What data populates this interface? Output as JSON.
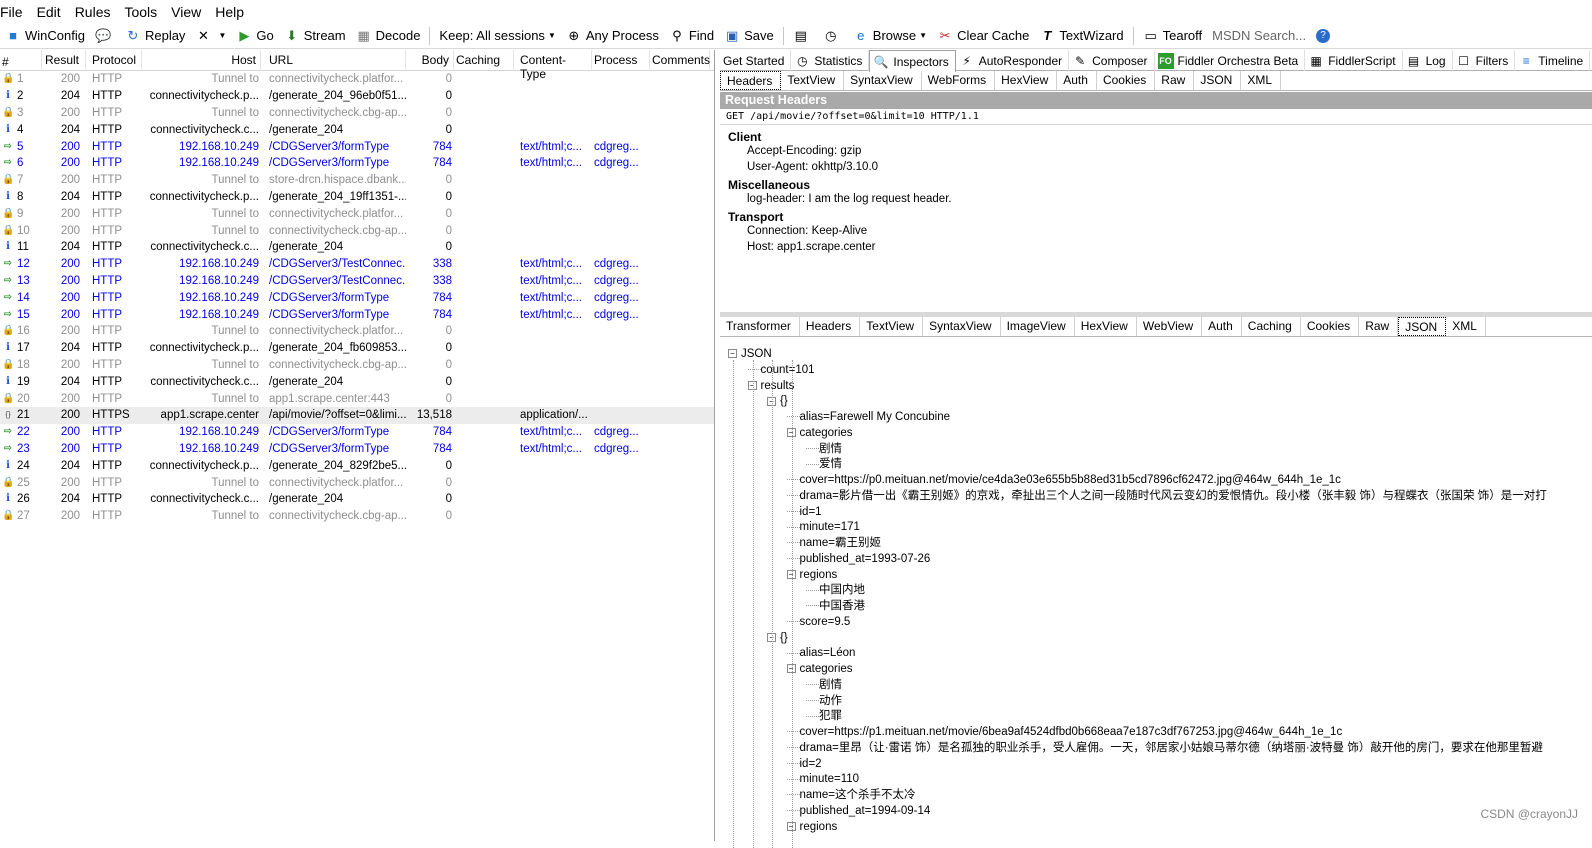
{
  "menu": [
    "File",
    "Edit",
    "Rules",
    "Tools",
    "View",
    "Help"
  ],
  "toolbar": {
    "winconfig": "WinConfig",
    "replay": "Replay",
    "go": "Go",
    "stream": "Stream",
    "decode": "Decode",
    "keep": "Keep: All sessions",
    "process": "Any Process",
    "find": "Find",
    "save": "Save",
    "browse": "Browse",
    "clear_cache": "Clear Cache",
    "textwizard": "TextWizard",
    "tearoff": "Tearoff",
    "msdn": "MSDN Search..."
  },
  "sessions": {
    "columns": [
      "#",
      "Result",
      "Protocol",
      "Host",
      "URL",
      "Body",
      "Caching",
      "Content-Type",
      "Process",
      "Comments"
    ],
    "rows": [
      {
        "num": "1",
        "result": "200",
        "protocol": "HTTP",
        "host": "Tunnel to",
        "url": "connectivitycheck.platfor...",
        "body": "0",
        "ctype": "",
        "process": "",
        "style": "tunnel",
        "icon": "lock"
      },
      {
        "num": "2",
        "result": "204",
        "protocol": "HTTP",
        "host": "connectivitycheck.p...",
        "url": "/generate_204_96eb0f51...",
        "body": "0",
        "ctype": "",
        "process": "",
        "style": "http204",
        "icon": "info"
      },
      {
        "num": "3",
        "result": "200",
        "protocol": "HTTP",
        "host": "Tunnel to",
        "url": "connectivitycheck.cbg-ap...",
        "body": "0",
        "ctype": "",
        "process": "",
        "style": "tunnel",
        "icon": "lock"
      },
      {
        "num": "4",
        "result": "204",
        "protocol": "HTTP",
        "host": "connectivitycheck.c...",
        "url": "/generate_204",
        "body": "0",
        "ctype": "",
        "process": "",
        "style": "http204",
        "icon": "info"
      },
      {
        "num": "5",
        "result": "200",
        "protocol": "HTTP",
        "host": "192.168.10.249",
        "url": "/CDGServer3/formType",
        "body": "784",
        "ctype": "text/html;c...",
        "process": "cdgreg...",
        "style": "blue",
        "icon": "arrow"
      },
      {
        "num": "6",
        "result": "200",
        "protocol": "HTTP",
        "host": "192.168.10.249",
        "url": "/CDGServer3/formType",
        "body": "784",
        "ctype": "text/html;c...",
        "process": "cdgreg...",
        "style": "blue",
        "icon": "arrow"
      },
      {
        "num": "7",
        "result": "200",
        "protocol": "HTTP",
        "host": "Tunnel to",
        "url": "store-drcn.hispace.dbank...",
        "body": "0",
        "ctype": "",
        "process": "",
        "style": "tunnel",
        "icon": "lock"
      },
      {
        "num": "8",
        "result": "204",
        "protocol": "HTTP",
        "host": "connectivitycheck.p...",
        "url": "/generate_204_19ff1351-...",
        "body": "0",
        "ctype": "",
        "process": "",
        "style": "http204",
        "icon": "info"
      },
      {
        "num": "9",
        "result": "200",
        "protocol": "HTTP",
        "host": "Tunnel to",
        "url": "connectivitycheck.platfor...",
        "body": "0",
        "ctype": "",
        "process": "",
        "style": "tunnel",
        "icon": "lock"
      },
      {
        "num": "10",
        "result": "200",
        "protocol": "HTTP",
        "host": "Tunnel to",
        "url": "connectivitycheck.cbg-ap...",
        "body": "0",
        "ctype": "",
        "process": "",
        "style": "tunnel",
        "icon": "lock"
      },
      {
        "num": "11",
        "result": "204",
        "protocol": "HTTP",
        "host": "connectivitycheck.c...",
        "url": "/generate_204",
        "body": "0",
        "ctype": "",
        "process": "",
        "style": "http204",
        "icon": "info"
      },
      {
        "num": "12",
        "result": "200",
        "protocol": "HTTP",
        "host": "192.168.10.249",
        "url": "/CDGServer3/TestConnec...",
        "body": "338",
        "ctype": "text/html;c...",
        "process": "cdgreg...",
        "style": "blue",
        "icon": "arrow"
      },
      {
        "num": "13",
        "result": "200",
        "protocol": "HTTP",
        "host": "192.168.10.249",
        "url": "/CDGServer3/TestConnec...",
        "body": "338",
        "ctype": "text/html;c...",
        "process": "cdgreg...",
        "style": "blue",
        "icon": "arrow"
      },
      {
        "num": "14",
        "result": "200",
        "protocol": "HTTP",
        "host": "192.168.10.249",
        "url": "/CDGServer3/formType",
        "body": "784",
        "ctype": "text/html;c...",
        "process": "cdgreg...",
        "style": "blue",
        "icon": "arrow"
      },
      {
        "num": "15",
        "result": "200",
        "protocol": "HTTP",
        "host": "192.168.10.249",
        "url": "/CDGServer3/formType",
        "body": "784",
        "ctype": "text/html;c...",
        "process": "cdgreg...",
        "style": "blue",
        "icon": "arrow"
      },
      {
        "num": "16",
        "result": "200",
        "protocol": "HTTP",
        "host": "Tunnel to",
        "url": "connectivitycheck.platfor...",
        "body": "0",
        "ctype": "",
        "process": "",
        "style": "tunnel",
        "icon": "lock"
      },
      {
        "num": "17",
        "result": "204",
        "protocol": "HTTP",
        "host": "connectivitycheck.p...",
        "url": "/generate_204_fb609853...",
        "body": "0",
        "ctype": "",
        "process": "",
        "style": "http204",
        "icon": "info"
      },
      {
        "num": "18",
        "result": "200",
        "protocol": "HTTP",
        "host": "Tunnel to",
        "url": "connectivitycheck.cbg-ap...",
        "body": "0",
        "ctype": "",
        "process": "",
        "style": "tunnel",
        "icon": "lock"
      },
      {
        "num": "19",
        "result": "204",
        "protocol": "HTTP",
        "host": "connectivitycheck.c...",
        "url": "/generate_204",
        "body": "0",
        "ctype": "",
        "process": "",
        "style": "http204",
        "icon": "info"
      },
      {
        "num": "20",
        "result": "200",
        "protocol": "HTTP",
        "host": "Tunnel to",
        "url": "app1.scrape.center:443",
        "body": "0",
        "ctype": "",
        "process": "",
        "style": "tunnel",
        "icon": "lock"
      },
      {
        "num": "21",
        "result": "200",
        "protocol": "HTTPS",
        "host": "app1.scrape.center",
        "url": "/api/movie/?offset=0&limi...",
        "body": "13,518",
        "ctype": "application/...",
        "process": "",
        "style": "sel",
        "icon": "https"
      },
      {
        "num": "22",
        "result": "200",
        "protocol": "HTTP",
        "host": "192.168.10.249",
        "url": "/CDGServer3/formType",
        "body": "784",
        "ctype": "text/html;c...",
        "process": "cdgreg...",
        "style": "blue",
        "icon": "arrow"
      },
      {
        "num": "23",
        "result": "200",
        "protocol": "HTTP",
        "host": "192.168.10.249",
        "url": "/CDGServer3/formType",
        "body": "784",
        "ctype": "text/html;c...",
        "process": "cdgreg...",
        "style": "blue",
        "icon": "arrow"
      },
      {
        "num": "24",
        "result": "204",
        "protocol": "HTTP",
        "host": "connectivitycheck.p...",
        "url": "/generate_204_829f2be5...",
        "body": "0",
        "ctype": "",
        "process": "",
        "style": "http204",
        "icon": "info"
      },
      {
        "num": "25",
        "result": "200",
        "protocol": "HTTP",
        "host": "Tunnel to",
        "url": "connectivitycheck.platfor...",
        "body": "0",
        "ctype": "",
        "process": "",
        "style": "tunnel",
        "icon": "lock"
      },
      {
        "num": "26",
        "result": "204",
        "protocol": "HTTP",
        "host": "connectivitycheck.c...",
        "url": "/generate_204",
        "body": "0",
        "ctype": "",
        "process": "",
        "style": "http204",
        "icon": "info"
      },
      {
        "num": "27",
        "result": "200",
        "protocol": "HTTP",
        "host": "Tunnel to",
        "url": "connectivitycheck.cbg-ap...",
        "body": "0",
        "ctype": "",
        "process": "",
        "style": "tunnel",
        "icon": "lock"
      }
    ]
  },
  "inspector_tabs": [
    "Get Started",
    "Statistics",
    "Inspectors",
    "AutoResponder",
    "Composer",
    "Fiddler Orchestra Beta",
    "FiddlerScript",
    "Log",
    "Filters",
    "Timeline"
  ],
  "request_tabs": [
    "Headers",
    "TextView",
    "SyntaxView",
    "WebForms",
    "HexView",
    "Auth",
    "Cookies",
    "Raw",
    "JSON",
    "XML"
  ],
  "request_headers": {
    "title": "Request Headers",
    "request_line": "GET /api/movie/?offset=0&limit=10 HTTP/1.1",
    "groups": [
      {
        "name": "Client",
        "items": [
          "Accept-Encoding: gzip",
          "User-Agent: okhttp/3.10.0"
        ]
      },
      {
        "name": "Miscellaneous",
        "items": [
          "log-header: I am the log request header."
        ]
      },
      {
        "name": "Transport",
        "items": [
          "Connection: Keep-Alive",
          "Host: app1.scrape.center"
        ]
      }
    ]
  },
  "response_tabs": [
    "Transformer",
    "Headers",
    "TextView",
    "SyntaxView",
    "ImageView",
    "HexView",
    "WebView",
    "Auth",
    "Caching",
    "Cookies",
    "Raw",
    "JSON",
    "XML"
  ],
  "json_tree": [
    {
      "depth": 0,
      "text": "JSON",
      "exp": true
    },
    {
      "depth": 1,
      "text": "count=101",
      "exp": false
    },
    {
      "depth": 1,
      "text": "results",
      "exp": true
    },
    {
      "depth": 2,
      "text": "{}",
      "exp": true
    },
    {
      "depth": 3,
      "text": "alias=Farewell My Concubine",
      "exp": false
    },
    {
      "depth": 3,
      "text": "categories",
      "exp": true
    },
    {
      "depth": 4,
      "text": "剧情",
      "exp": false
    },
    {
      "depth": 4,
      "text": "爱情",
      "exp": false
    },
    {
      "depth": 3,
      "text": "cover=https://p0.meituan.net/movie/ce4da3e03e655b5b88ed31b5cd7896cf62472.jpg@464w_644h_1e_1c",
      "exp": false
    },
    {
      "depth": 3,
      "text": "drama=影片借一出《霸王别姬》的京戏，牵扯出三个人之间一段随时代风云变幻的爱恨情仇。段小楼（张丰毅 饰）与程蝶衣（张国荣 饰）是一对打",
      "exp": false
    },
    {
      "depth": 3,
      "text": "id=1",
      "exp": false
    },
    {
      "depth": 3,
      "text": "minute=171",
      "exp": false
    },
    {
      "depth": 3,
      "text": "name=霸王别姬",
      "exp": false
    },
    {
      "depth": 3,
      "text": "published_at=1993-07-26",
      "exp": false
    },
    {
      "depth": 3,
      "text": "regions",
      "exp": true
    },
    {
      "depth": 4,
      "text": "中国内地",
      "exp": false
    },
    {
      "depth": 4,
      "text": "中国香港",
      "exp": false
    },
    {
      "depth": 3,
      "text": "score=9.5",
      "exp": false
    },
    {
      "depth": 2,
      "text": "{}",
      "exp": true
    },
    {
      "depth": 3,
      "text": "alias=Léon",
      "exp": false
    },
    {
      "depth": 3,
      "text": "categories",
      "exp": true
    },
    {
      "depth": 4,
      "text": "剧情",
      "exp": false
    },
    {
      "depth": 4,
      "text": "动作",
      "exp": false
    },
    {
      "depth": 4,
      "text": "犯罪",
      "exp": false
    },
    {
      "depth": 3,
      "text": "cover=https://p1.meituan.net/movie/6bea9af4524dfbd0b668eaa7e187c3df767253.jpg@464w_644h_1e_1c",
      "exp": false
    },
    {
      "depth": 3,
      "text": "drama=里昂（让·雷诺 饰）是名孤独的职业杀手，受人雇佣。一天，邻居家小姑娘马蒂尔德（纳塔丽·波特曼 饰）敲开他的房门，要求在他那里暂避",
      "exp": false
    },
    {
      "depth": 3,
      "text": "id=2",
      "exp": false
    },
    {
      "depth": 3,
      "text": "minute=110",
      "exp": false
    },
    {
      "depth": 3,
      "text": "name=这个杀手不太冷",
      "exp": false
    },
    {
      "depth": 3,
      "text": "published_at=1994-09-14",
      "exp": false
    },
    {
      "depth": 3,
      "text": "regions",
      "exp": true
    }
  ],
  "watermark": "CSDN @crayonJJ"
}
